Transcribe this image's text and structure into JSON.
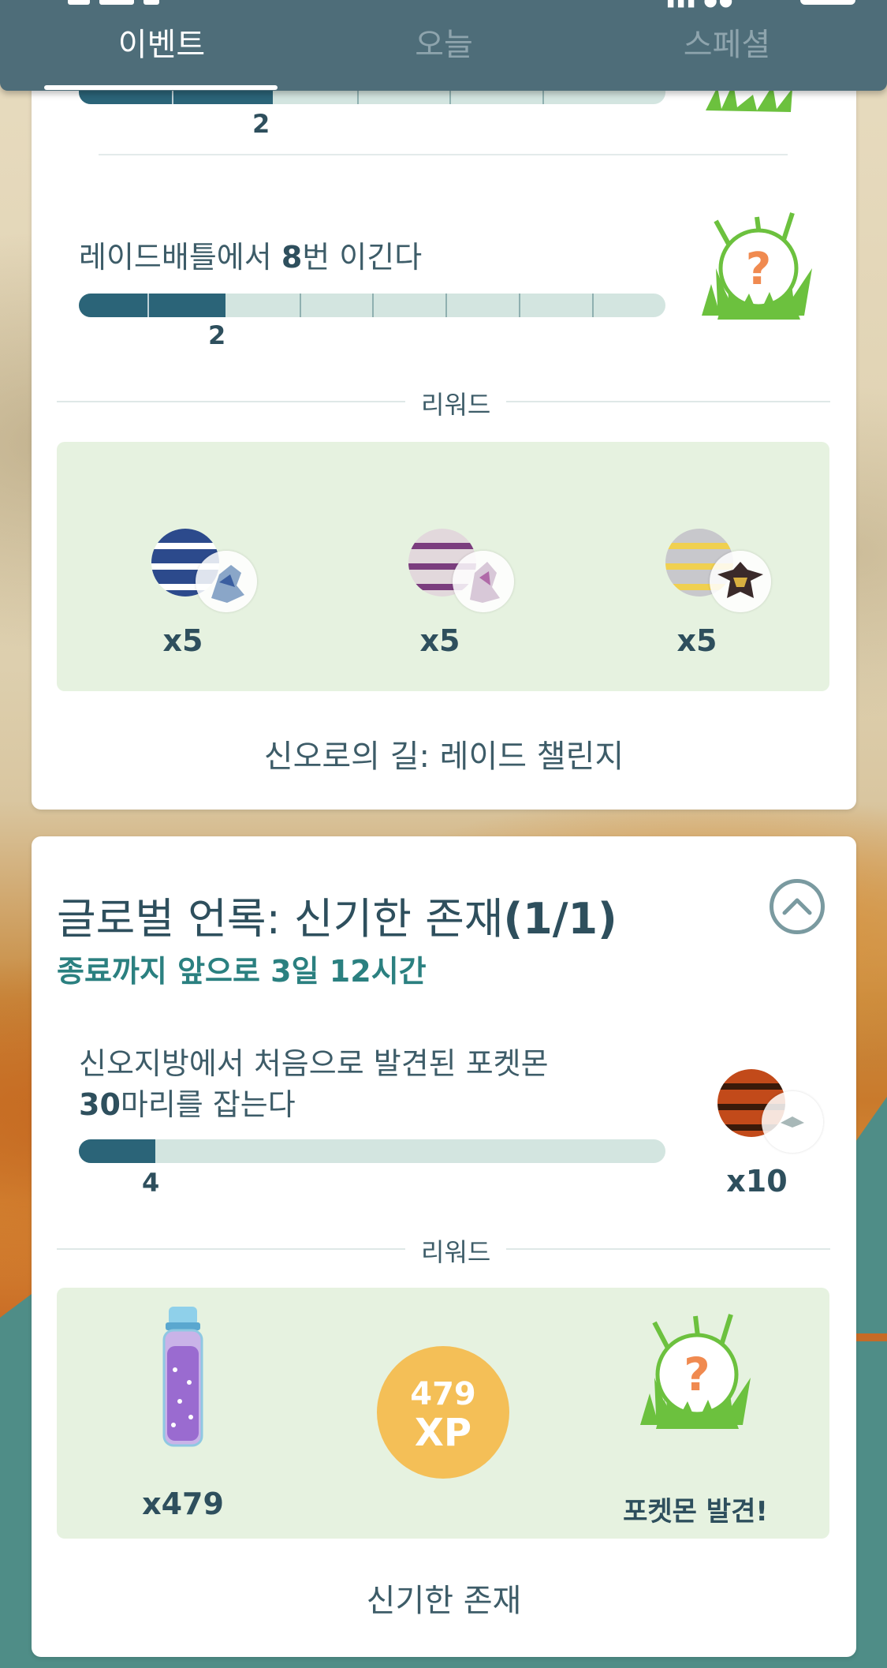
{
  "tabs": [
    {
      "label": "이벤트"
    },
    {
      "label": "오늘"
    },
    {
      "label": "스페셜"
    }
  ],
  "card1": {
    "prev_task": {
      "progress_count": "2",
      "progress_fraction": 0.33
    },
    "task": {
      "text_before": "레이드배틀에서 ",
      "text_bold": "8",
      "text_after": "번 이긴다",
      "progress_count": "2",
      "progress_fraction": 0.25
    },
    "rewards_label": "리워드",
    "rewards": [
      {
        "icon": "dialga-encounter-icon",
        "qty": "x5"
      },
      {
        "icon": "palkia-encounter-icon",
        "qty": "x5"
      },
      {
        "icon": "giratina-encounter-icon",
        "qty": "x5"
      }
    ],
    "footer": "신오로의 길: 레이드 챌린지"
  },
  "card2": {
    "title_main": "글로벌 언록: 신기한 존재",
    "title_count": "(1/1)",
    "subtitle": "종료까지 앞으로 3일 12시간",
    "task": {
      "line1": "신오지방에서 처음으로 발견된 포켓몬",
      "line2_bold": "30",
      "line2_rest": "마리를 잡는다",
      "progress_count": "4",
      "progress_fraction": 0.13,
      "reward_qty": "x10"
    },
    "rewards_label": "리워드",
    "rewards": {
      "stardust_qty": "x479",
      "xp_number": "479",
      "xp_unit": "XP",
      "discover_label": "포켓몬 발견!"
    },
    "footer": "신기한 존재"
  },
  "colors": {
    "header": "#4e6d79",
    "progress_fill": "#2b6478",
    "progress_track": "#d3e5e0",
    "reward_box": "#e6f2e0",
    "xp": "#f4bf57",
    "subtitle": "#2b8080"
  }
}
